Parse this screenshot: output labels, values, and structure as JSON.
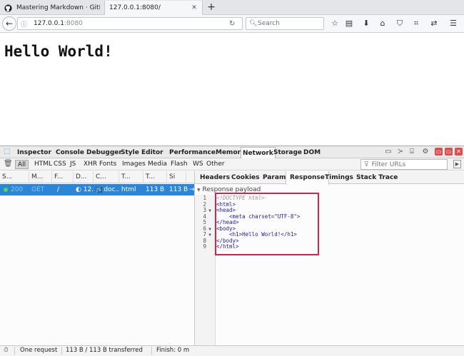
{
  "browser": {
    "tabs": [
      {
        "title": "Mastering Markdown · GitHub",
        "active": false
      },
      {
        "title": "127.0.0.1:8080/",
        "active": true
      }
    ],
    "new_tab_label": "+",
    "url": {
      "host": "127.0.0.1",
      "port": ":8080"
    },
    "search_placeholder": "Search"
  },
  "page": {
    "heading": "Hello World!"
  },
  "devtools": {
    "tabs": [
      "Inspector",
      "Console",
      "Debugger",
      "Style Editor",
      "Performance",
      "Memory",
      "Network",
      "Storage",
      "DOM"
    ],
    "selected_tab": "Network",
    "filters": [
      "All",
      "HTML",
      "CSS",
      "JS",
      "XHR",
      "Fonts",
      "Images",
      "Media",
      "Flash",
      "WS",
      "Other"
    ],
    "selected_filter": "All",
    "filter_urls_placeholder": "Filter URLs",
    "columns": [
      "S...",
      "M...",
      "F...",
      "D...",
      "C...",
      "T...",
      "T...",
      "Si"
    ],
    "request": {
      "status": "200",
      "method": "GET",
      "file": "/",
      "domain": "12...",
      "cause_badge": "JS",
      "cause": "doc...",
      "type": "html",
      "transferred": "113 B",
      "size": "113 B",
      "timeline": "→"
    },
    "detail_tabs": [
      "Headers",
      "Cookies",
      "Params",
      "Response",
      "Timings",
      "Stack Trace"
    ],
    "selected_detail_tab": "Response",
    "payload_label": "Response payload",
    "code_lines": [
      {
        "n": "1",
        "fold": "",
        "text": "<!DOCTYPE html>"
      },
      {
        "n": "2",
        "fold": "",
        "text": "<html>"
      },
      {
        "n": "3",
        "fold": "▼",
        "text": "<head>"
      },
      {
        "n": "4",
        "fold": "",
        "text": "    <meta charset=\"UTF-8\">"
      },
      {
        "n": "5",
        "fold": "",
        "text": "</head>"
      },
      {
        "n": "6",
        "fold": "▼",
        "text": "<body>"
      },
      {
        "n": "7",
        "fold": "▼",
        "text": "    <h1>Hello World!</h1>"
      },
      {
        "n": "8",
        "fold": "",
        "text": "</body>"
      },
      {
        "n": "9",
        "fold": "",
        "text": "</html>"
      }
    ],
    "status": {
      "requests": "One request",
      "transferred": "113 B / 113 B transferred",
      "finish": "Finish: 0 m"
    }
  },
  "colors": {
    "selected_row": "#2c86d8",
    "highlight_border": "#d1254d",
    "status_ok": "#5ad448"
  }
}
